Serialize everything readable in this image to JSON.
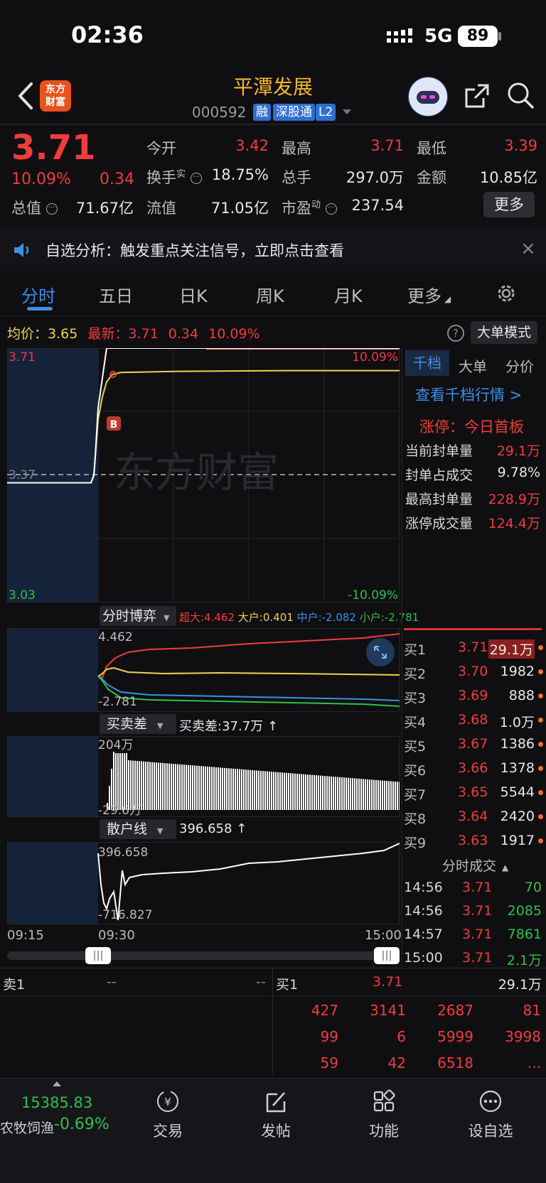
{
  "status_bar": {
    "time": "02:36",
    "network": "5G",
    "battery": "89"
  },
  "header": {
    "stock_name": "平潭发展",
    "stock_code": "000592",
    "logo_text": "东方财富",
    "tags": [
      "融",
      "深股通",
      "L2"
    ]
  },
  "quote": {
    "price": "3.71",
    "change_pct": "10.09%",
    "change": "0.34",
    "open_label": "今开",
    "open_value": "3.42",
    "high_label": "最高",
    "high_value": "3.71",
    "low_label": "最低",
    "low_value": "3.39",
    "turnover_label": "换手",
    "turnover_sup": "实",
    "turnover_value": "18.75%",
    "volume_label": "总手",
    "volume_value": "297.0万",
    "amount_label": "金额",
    "amount_value": "10.85亿",
    "mktcap_label": "总值",
    "mktcap_value": "71.67亿",
    "float_label": "流值",
    "float_value": "71.05亿",
    "pe_label": "市盈",
    "pe_sup": "动",
    "pe_value": "237.54",
    "more_button": "更多"
  },
  "notice": {
    "text": "自选分析：触发重点关注信号，立即点击查看",
    "close": "×"
  },
  "tabs": [
    "分时",
    "五日",
    "日K",
    "周K",
    "月K",
    "更多"
  ],
  "chart": {
    "avg_label": "均价：",
    "avg_value": "3.65",
    "latest_label": "最新：",
    "latest_value": "3.71",
    "latest_change": "0.34",
    "latest_pct": "10.09%",
    "mode_button": "大单模式",
    "price_top": "3.71",
    "price_mid": "3.37",
    "price_bottom": "3.03",
    "pct_top": "10.09%",
    "pct_bottom": "-10.09%",
    "watermark": "东方财富",
    "buy_marker": "B",
    "times": [
      "09:15",
      "09:30",
      "15:00"
    ]
  },
  "chart_data": {
    "type": "line",
    "xlabel": "",
    "ylabel": "",
    "ylim": [
      3.03,
      3.71
    ],
    "series": [
      {
        "name": "最新",
        "values": [
          3.35,
          3.35,
          3.35,
          3.37,
          3.42,
          3.55,
          3.63,
          3.71,
          3.71,
          3.71,
          3.71,
          3.71,
          3.71
        ]
      },
      {
        "name": "均价",
        "values": [
          3.35,
          3.35,
          3.35,
          3.37,
          3.42,
          3.52,
          3.58,
          3.62,
          3.64,
          3.645,
          3.648,
          3.65,
          3.65
        ]
      }
    ]
  },
  "game_panel": {
    "dropdown": "分时博弈",
    "super": "超大:4.462",
    "large": "大户:0.401",
    "mid": "中户:-2.082",
    "small": "小户:-2.781",
    "y_top": "4.462",
    "y_bottom": "-2.781"
  },
  "diff_panel": {
    "dropdown": "买卖差",
    "value_text": "买卖差:37.7万 ↑",
    "y_top": "204万",
    "y_bottom": "-29.6万"
  },
  "retail_panel": {
    "dropdown": "散户线",
    "value_text": "396.658 ↑",
    "y_top": "396.658",
    "y_bottom": "-716.827"
  },
  "side": {
    "tabs": [
      "千档",
      "大单",
      "分价"
    ],
    "detail_link": "查看千档行情 >",
    "limit_text": "涨停：今日首板",
    "seal_rows": [
      {
        "label": "当前封单量",
        "value": "29.1万"
      },
      {
        "label": "封单占成交",
        "value": "9.78%"
      },
      {
        "label": "最高封单量",
        "value": "228.9万"
      },
      {
        "label": "涨停成交量",
        "value": "124.4万"
      }
    ],
    "bids": [
      {
        "label": "买1",
        "price": "3.71",
        "vol": "29.1万"
      },
      {
        "label": "买2",
        "price": "3.70",
        "vol": "1982"
      },
      {
        "label": "买3",
        "price": "3.69",
        "vol": "888"
      },
      {
        "label": "买4",
        "price": "3.68",
        "vol": "1.0万"
      },
      {
        "label": "买5",
        "price": "3.67",
        "vol": "1386"
      },
      {
        "label": "买6",
        "price": "3.66",
        "vol": "1378"
      },
      {
        "label": "买7",
        "price": "3.65",
        "vol": "5544"
      },
      {
        "label": "买8",
        "price": "3.64",
        "vol": "2420"
      },
      {
        "label": "买9",
        "price": "3.63",
        "vol": "1917"
      }
    ],
    "trades_header": "分时成交",
    "trades": [
      {
        "time": "14:56",
        "price": "3.71",
        "vol": "70"
      },
      {
        "time": "14:56",
        "price": "3.71",
        "vol": "2085"
      },
      {
        "time": "14:57",
        "price": "3.71",
        "vol": "7861"
      },
      {
        "time": "15:00",
        "price": "3.71",
        "vol": "2.1万"
      }
    ]
  },
  "order_panel": {
    "sell1_label": "卖1",
    "sell1_price": "--",
    "sell1_vol": "--",
    "buy1_label": "买1",
    "buy1_price": "3.71",
    "buy1_vol": "29.1万",
    "queue": [
      [
        "427",
        "3141",
        "2687",
        "81"
      ],
      [
        "99",
        "6",
        "5999",
        "3998"
      ],
      [
        "59",
        "42",
        "6518",
        "..."
      ]
    ]
  },
  "bottom_nav": {
    "index_value": "15385.83",
    "index_name": "农牧饲渔",
    "index_pct": "-0.69%",
    "items": [
      "交易",
      "发帖",
      "功能",
      "设自选"
    ]
  }
}
